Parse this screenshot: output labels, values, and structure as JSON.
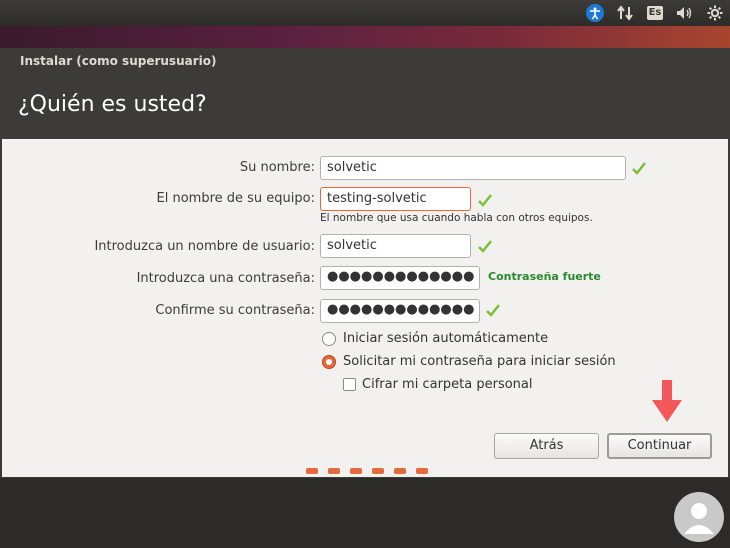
{
  "topbar": {
    "keyboard_layout": "Es",
    "icons": [
      "accessibility-icon",
      "network-icon",
      "keyboard-icon",
      "volume-icon",
      "settings-icon"
    ]
  },
  "window": {
    "title": "Instalar (como superusuario)",
    "heading": "¿Quién es usted?"
  },
  "form": {
    "name_label": "Su nombre:",
    "name_value": "solvetic",
    "computer_label": "El nombre de su equipo:",
    "computer_value": "testing-solvetic",
    "computer_hint": "El nombre que usa cuando habla con otros equipos.",
    "username_label": "Introduzca un nombre de usuario:",
    "username_value": "solvetic",
    "password_label": "Introduzca una contraseña:",
    "password_value": "●●●●●●●●●●●●●",
    "password_strength": "Contraseña fuerte",
    "confirm_label": "Confirme su contraseña:",
    "confirm_value": "●●●●●●●●●●●●●",
    "option_autologin": "Iniciar sesión automáticamente",
    "option_require_password": "Solicitar mi contraseña para iniciar sesión",
    "option_encrypt": "Cifrar mi carpeta personal",
    "selected_option": "option_require_password",
    "encrypt_checked": false
  },
  "buttons": {
    "back": "Atrás",
    "continue": "Continuar"
  },
  "progress": {
    "steps_shown": 6
  },
  "colors": {
    "accent": "#e4693b",
    "check": "#7cbf3a",
    "strength": "#2b8a2b",
    "arrow": "#f2585a"
  }
}
